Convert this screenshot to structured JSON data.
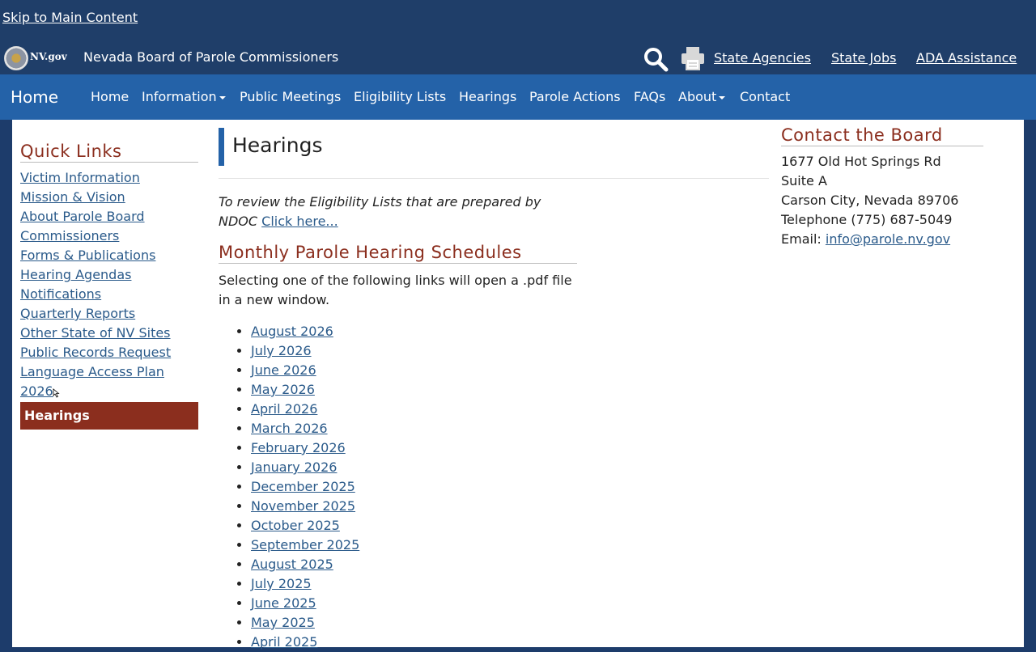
{
  "top": {
    "skip_link": "Skip to Main Content",
    "logo_text": "NV.gov",
    "site_name": "Nevada Board of Parole Commissioners",
    "links": [
      "State Agencies",
      "State Jobs",
      "ADA Assistance"
    ]
  },
  "nav": {
    "brand": "Home",
    "items": [
      "Home",
      "Information",
      "Public Meetings",
      "Eligibility Lists",
      "Hearings",
      "Parole Actions",
      "FAQs",
      "About",
      "Contact"
    ]
  },
  "sidebar": {
    "title": "Quick Links",
    "links": [
      "Victim Information",
      "Mission & Vision",
      "About Parole Board",
      "Commissioners",
      "Forms & Publications",
      "Hearing Agendas",
      "Notifications",
      "Quarterly Reports",
      "Other State of NV Sites",
      "Public Records Request",
      "Language Access Plan",
      "2026"
    ],
    "active": "Hearings"
  },
  "main": {
    "title": "Hearings",
    "intro": "To review the Eligibility Lists that are prepared by NDOC",
    "intro_link": "Click here...",
    "schedules_title": "Monthly Parole Hearing Schedules",
    "schedules_desc": "Selecting one of the following links will open a .pdf file in a new window.",
    "months": [
      "August 2026",
      "July 2026",
      "June 2026",
      "May 2026",
      "April 2026",
      "March 2026",
      "February 2026",
      "January 2026",
      "December 2025",
      "November 2025",
      "October 2025",
      "September 2025",
      "August 2025",
      "July 2025",
      "June 2025",
      "May 2025",
      "April 2025"
    ]
  },
  "contact": {
    "title": "Contact the Board",
    "address1": "1677 Old Hot Springs Rd",
    "address2": "Suite A",
    "city": "Carson City, Nevada 89706",
    "phone": "Telephone (775) 687-5049",
    "email_label": "Email:",
    "email": "info@parole.nv.gov"
  },
  "colors": {
    "header_bg": "#1f3e69",
    "nav_bg": "#2462a8",
    "heading_red": "#8b2e1e",
    "link": "#2a5a8a"
  }
}
